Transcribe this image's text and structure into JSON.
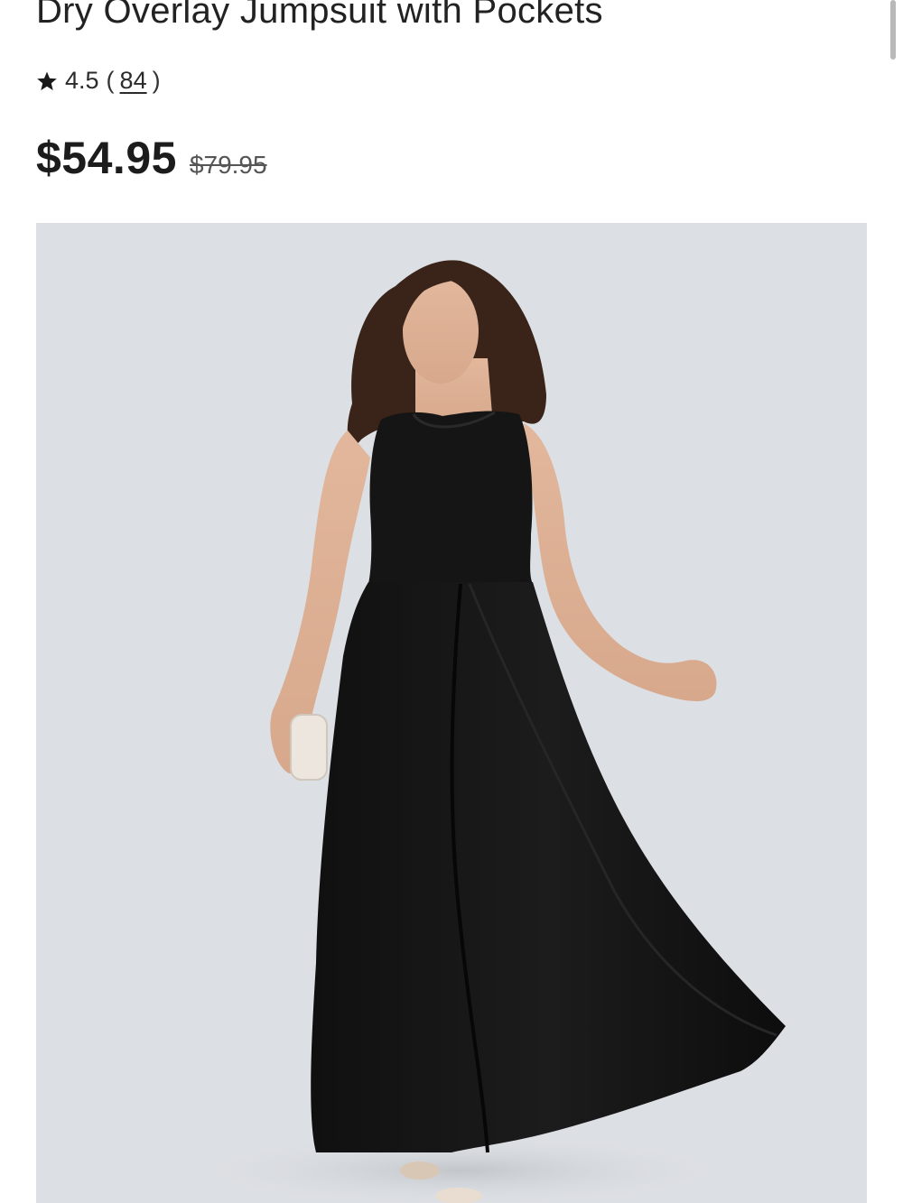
{
  "product": {
    "title": "Dry Overlay Jumpsuit with Pockets",
    "rating": {
      "value": "4.5",
      "open_paren": "(",
      "review_count": "84",
      "close_paren": ")"
    },
    "price": {
      "current": "$54.95",
      "original": "$79.95"
    },
    "image": {
      "background_color": "#dcdfe3",
      "garment_color": "#141414"
    }
  },
  "icons": {
    "rating_star": "star-icon"
  }
}
